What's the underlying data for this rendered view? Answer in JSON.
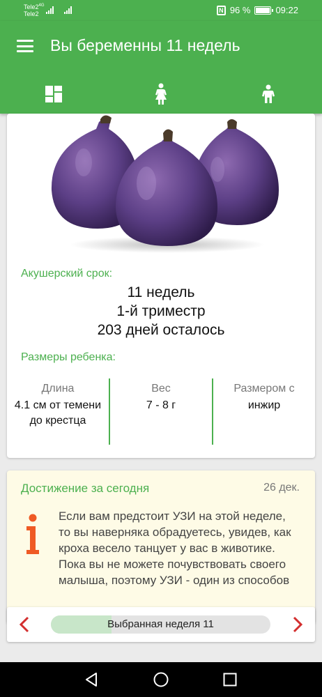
{
  "status": {
    "carrier1": "Tele2",
    "carrier1_net": "4G",
    "carrier2": "Tele2",
    "battery": "96 %",
    "time": "09:22",
    "nfc_icon": "nfc-icon",
    "battery_icon": "battery-icon"
  },
  "app_bar": {
    "title": "Вы беременны 11 недель",
    "menu_icon": "hamburger-menu-icon",
    "tabs": [
      {
        "icon": "dashboard-icon"
      },
      {
        "icon": "pregnant-woman-icon"
      },
      {
        "icon": "baby-icon"
      }
    ],
    "color": "#4cb04f"
  },
  "term": {
    "label": "Акушерский срок:",
    "weeks": "11 недель",
    "trimester": "1-й триместр",
    "days_left": "203 дней осталось"
  },
  "baby_size": {
    "label": "Размеры ребенка:",
    "length_label": "Длина",
    "length_value": "4.1 см от темени до крестца",
    "weight_label": "Вес",
    "weight_value": "7 - 8 г",
    "compare_label": "Размером с",
    "compare_value": "инжир"
  },
  "achievement": {
    "title": "Достижение за сегодня",
    "date": "26 дек.",
    "text": "Если вам предстоит УЗИ на этой неделе, то вы наверняка обрадуетесь, увидев, как кроха весело танцует у вас в животике. Пока вы не можете почувствовать своего малыша, поэтому УЗИ - один из способов",
    "icon": "info-icon",
    "accent": "#ef5a24"
  },
  "week_selector": {
    "label": "Выбранная неделя 11",
    "progress": 0.275,
    "prev_icon": "chevron-left-icon",
    "next_icon": "chevron-right-icon",
    "arrow_color": "#d32f2f"
  },
  "nav": {
    "back_icon": "back-icon",
    "home_icon": "home-icon",
    "recents_icon": "recents-icon"
  }
}
